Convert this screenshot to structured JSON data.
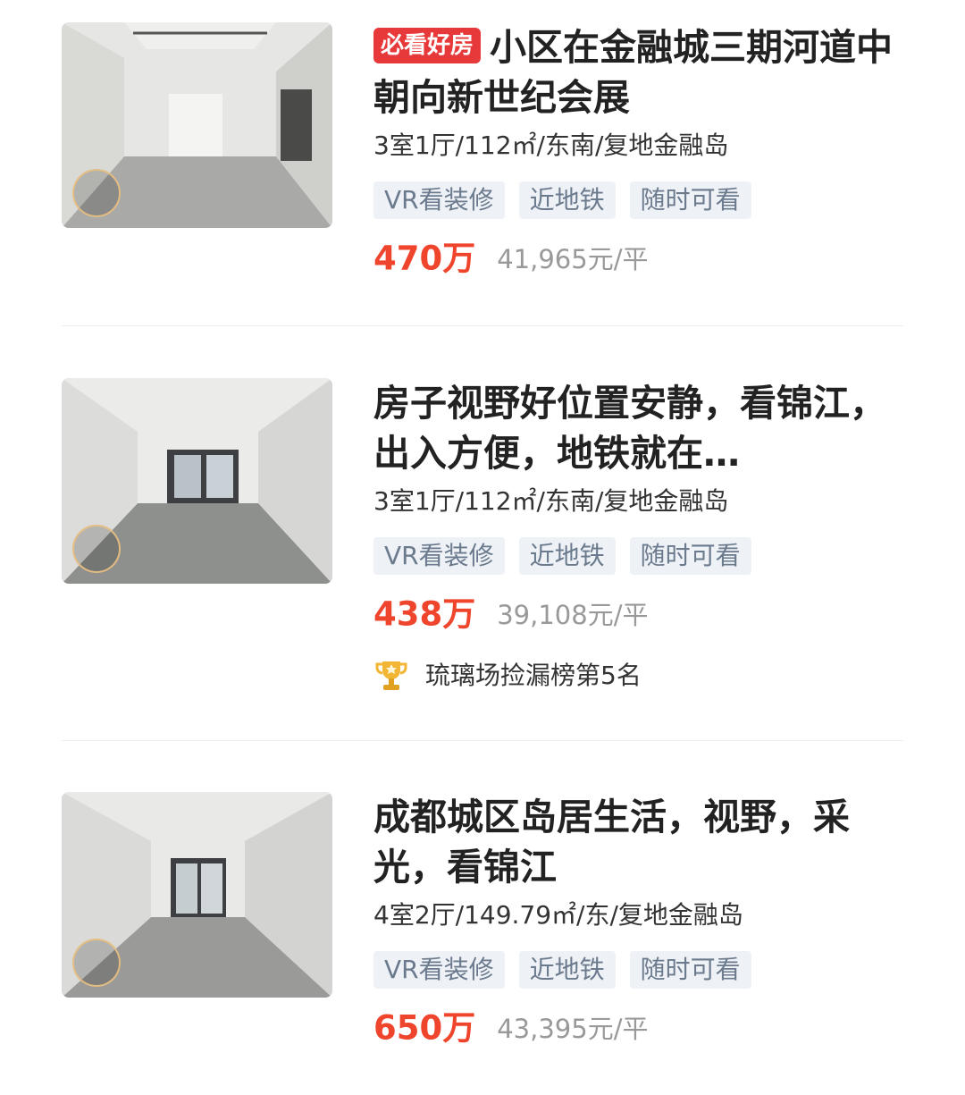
{
  "listings": [
    {
      "tag": "必看好房",
      "title": "小区在金融城三期河道中 朝向新世纪会展",
      "meta": "3室1厅/112㎡/东南/复地金融岛",
      "features": [
        "VR看装修",
        "近地铁",
        "随时可看"
      ],
      "price": "470万",
      "unit_price": "41,965元/平",
      "icon": "vr-badge-icon"
    },
    {
      "title": "房子视野好位置安静，看锦江，出入方便，地铁就在…",
      "meta": "3室1厅/112㎡/东南/复地金融岛",
      "features": [
        "VR看装修",
        "近地铁",
        "随时可看"
      ],
      "price": "438万",
      "unit_price": "39,108元/平",
      "rank": "琉璃场捡漏榜第5名",
      "icon": "vr-badge-icon"
    },
    {
      "title": "成都城区岛居生活，视野，采光，看锦江",
      "meta": "4室2厅/149.79㎡/东/复地金融岛",
      "features": [
        "VR看装修",
        "近地铁",
        "随时可看"
      ],
      "price": "650万",
      "unit_price": "43,395元/平",
      "icon": "vr-badge-icon"
    }
  ],
  "colors": {
    "price": "#f0452d",
    "hot_tag": "#e8393a",
    "feature_bg": "#eef2f7",
    "feature_text": "#6b7a8d"
  }
}
